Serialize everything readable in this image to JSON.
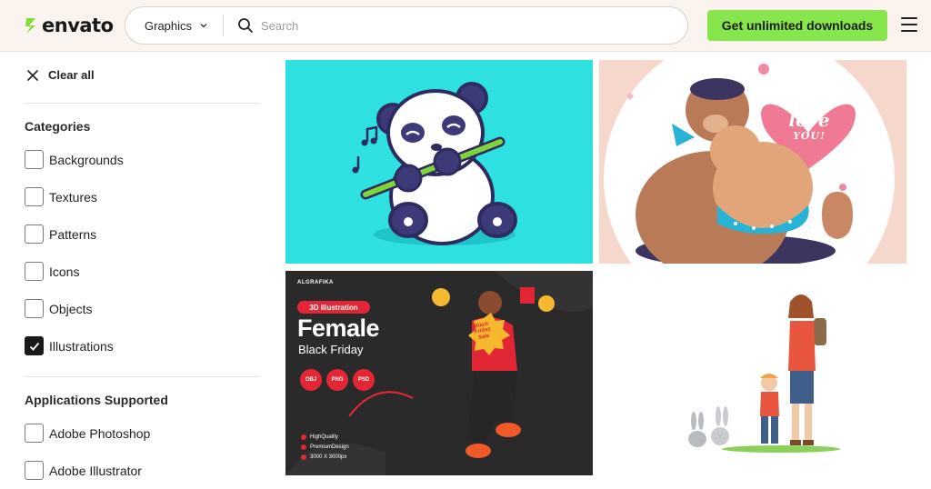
{
  "header": {
    "logo_text": "envato",
    "category_select": "Graphics",
    "search_placeholder": "Search",
    "cta_label": "Get unlimited downloads"
  },
  "sidebar": {
    "clear_all": "Clear all",
    "categories_title": "Categories",
    "categories": [
      {
        "label": "Backgrounds",
        "checked": false
      },
      {
        "label": "Textures",
        "checked": false
      },
      {
        "label": "Patterns",
        "checked": false
      },
      {
        "label": "Icons",
        "checked": false
      },
      {
        "label": "Objects",
        "checked": false
      },
      {
        "label": "Illustrations",
        "checked": true
      }
    ],
    "apps_title": "Applications Supported",
    "apps": [
      {
        "label": "Adobe Photoshop",
        "checked": false
      },
      {
        "label": "Adobe Illustrator",
        "checked": false
      }
    ]
  },
  "grid": {
    "items": [
      {
        "name": "panda-flute-illustration"
      },
      {
        "name": "bears-love-illustration",
        "text_love_1": "I",
        "text_love_2": "love",
        "text_love_3": "YOU!"
      },
      {
        "name": "female-black-friday-3d",
        "brand": "ALGRAFIKA",
        "badge": "3D Illustration",
        "headline": "Female",
        "subline": "Black Friday",
        "sale_1": "Black",
        "sale_2": "Friday",
        "sale_3": "Sale",
        "formats": [
          "OBJ",
          "PNG",
          "PSD"
        ],
        "features": [
          "HighQuality",
          "PremiumDesign",
          "3000 X 3000px"
        ]
      },
      {
        "name": "mother-child-hiking-illustration"
      }
    ]
  },
  "colors": {
    "accent_green": "#87e64b",
    "header_bg": "#fbf4ee",
    "badge_red": "#e32636"
  }
}
